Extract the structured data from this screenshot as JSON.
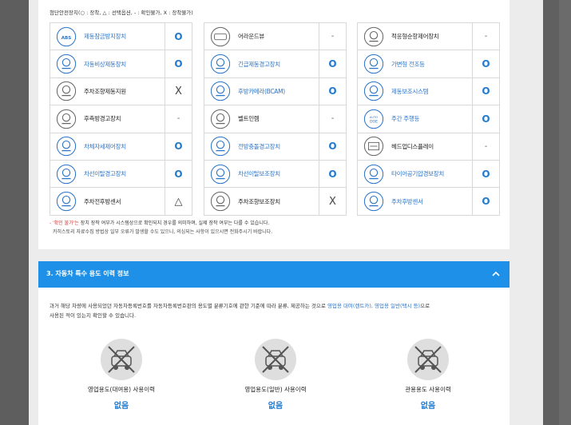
{
  "legend": "첨단안전장치(○ : 장착, △ : 선택옵션, - : 확인불가, X : 장착불가)",
  "columns": [
    [
      {
        "icon": "abs-icon",
        "name": "제동잠금방지장치",
        "status": "O",
        "tone": "blue"
      },
      {
        "icon": "emergency-brake-icon",
        "name": "자동비상제동장치",
        "status": "O",
        "tone": "blue"
      },
      {
        "icon": "parking-steering-icon",
        "name": "주차조향제동지원",
        "status": "X",
        "tone": "dark"
      },
      {
        "icon": "rear-side-warning-icon",
        "name": "후측방경고장치",
        "status": "-",
        "tone": "dark"
      },
      {
        "icon": "stability-control-icon",
        "name": "차체자세제어장치",
        "status": "O",
        "tone": "blue"
      },
      {
        "icon": "lane-departure-icon",
        "name": "차선이탈경고장치",
        "status": "O",
        "tone": "blue"
      },
      {
        "icon": "parking-front-sensor-icon",
        "name": "주차전후방센서",
        "status": "△",
        "tone": "dark"
      }
    ],
    [
      {
        "icon": "around-view-icon",
        "name": "어라운드뷰",
        "status": "-",
        "tone": "dark"
      },
      {
        "icon": "emergency-brake-warning-icon",
        "name": "긴급제동경고장치",
        "status": "O",
        "tone": "blue"
      },
      {
        "icon": "rear-camera-icon",
        "name": "후방카메라(BCAM)",
        "status": "O",
        "tone": "blue"
      },
      {
        "icon": "belt-pretension-icon",
        "name": "벨트인렘",
        "status": "-",
        "tone": "dark"
      },
      {
        "icon": "forward-collision-icon",
        "name": "전방충돌경고장치",
        "status": "O",
        "tone": "blue"
      },
      {
        "icon": "lane-keep-assist-icon",
        "name": "차선이탈보조장치",
        "status": "O",
        "tone": "blue"
      },
      {
        "icon": "parking-assist-icon",
        "name": "주차조향보조장치",
        "status": "X",
        "tone": "dark"
      }
    ],
    [
      {
        "icon": "adaptive-cruise-icon",
        "name": "적응형순항제어장치",
        "status": "-",
        "tone": "dark"
      },
      {
        "icon": "adaptive-headlight-icon",
        "name": "가변형 전조등",
        "status": "O",
        "tone": "blue"
      },
      {
        "icon": "brake-assist-icon",
        "name": "제동보조시스템",
        "status": "O",
        "tone": "blue"
      },
      {
        "icon": "daytime-running-light-icon",
        "name": "주간 주행등",
        "status": "O",
        "tone": "blue"
      },
      {
        "icon": "head-up-display-icon",
        "name": "헤드업디스플레이",
        "status": "-",
        "tone": "dark"
      },
      {
        "icon": "tire-pressure-icon",
        "name": "타이어공기압경보장치",
        "status": "O",
        "tone": "blue"
      },
      {
        "icon": "rear-parking-sensor-icon",
        "name": "주차후방센서",
        "status": "O",
        "tone": "blue"
      }
    ]
  ],
  "notes": {
    "line1_red": "- '확인 불가'는",
    "line1_rest": " 장치 장착 여부가 시스템상으로 확인되지 경우를 의미하며, 실제 장착 여부는 다를 수 있습니다.",
    "line2": "카히스토리 자료수집 방법상 일부 오류가 발생할 수도 있으니, 의심되는 사항이 있으시면 전화주시기 바랍니다."
  },
  "section3": {
    "title": "3. 자동차 특수 용도 이력 정보",
    "desc_a": "과거 해당 차량에 사용되었던 자동차등록번호를 자동차등록번호판의 용도별 분류기호에 관한 기준에 따라 분류, 제공하는 것으로 ",
    "desc_link": "영업용 대여(렌트카), 영업용 일반(택시 등)",
    "desc_b": "으로",
    "desc_line2": "사용된 적이 있는지 확인할 수 있습니다.",
    "items": [
      {
        "icon": "rental-car-icon",
        "label": "영업용도(대여용) 사용이력",
        "value": "없음"
      },
      {
        "icon": "taxi-icon",
        "label": "영업용도(일반) 사용이력",
        "value": "없음"
      },
      {
        "icon": "government-car-icon",
        "label": "관용용도 사용이력",
        "value": "없음"
      }
    ]
  }
}
